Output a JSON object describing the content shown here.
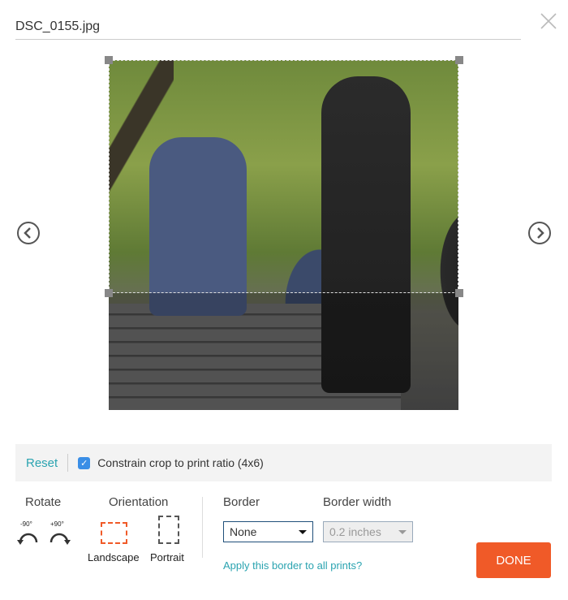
{
  "header": {
    "filename": "DSC_0155.jpg",
    "close_icon": "close-x-icon"
  },
  "toolbar": {
    "reset_label": "Reset",
    "constrain_label": "Constrain crop to print ratio (4x6)",
    "constrain_checked": true
  },
  "rotate": {
    "label": "Rotate",
    "left": "-90°",
    "right": "+90°"
  },
  "orientation": {
    "label": "Orientation",
    "landscape": "Landscape",
    "portrait": "Portrait",
    "selected": "Landscape"
  },
  "border": {
    "label": "Border",
    "value": "None",
    "width_label": "Border width",
    "width_value": "0.2 inches",
    "apply_all": "Apply this border to all prints?"
  },
  "done_label": "DONE",
  "colors": {
    "accent": "#2aa3b0",
    "done": "#f05a28",
    "checkbox": "#3a8ee6"
  }
}
